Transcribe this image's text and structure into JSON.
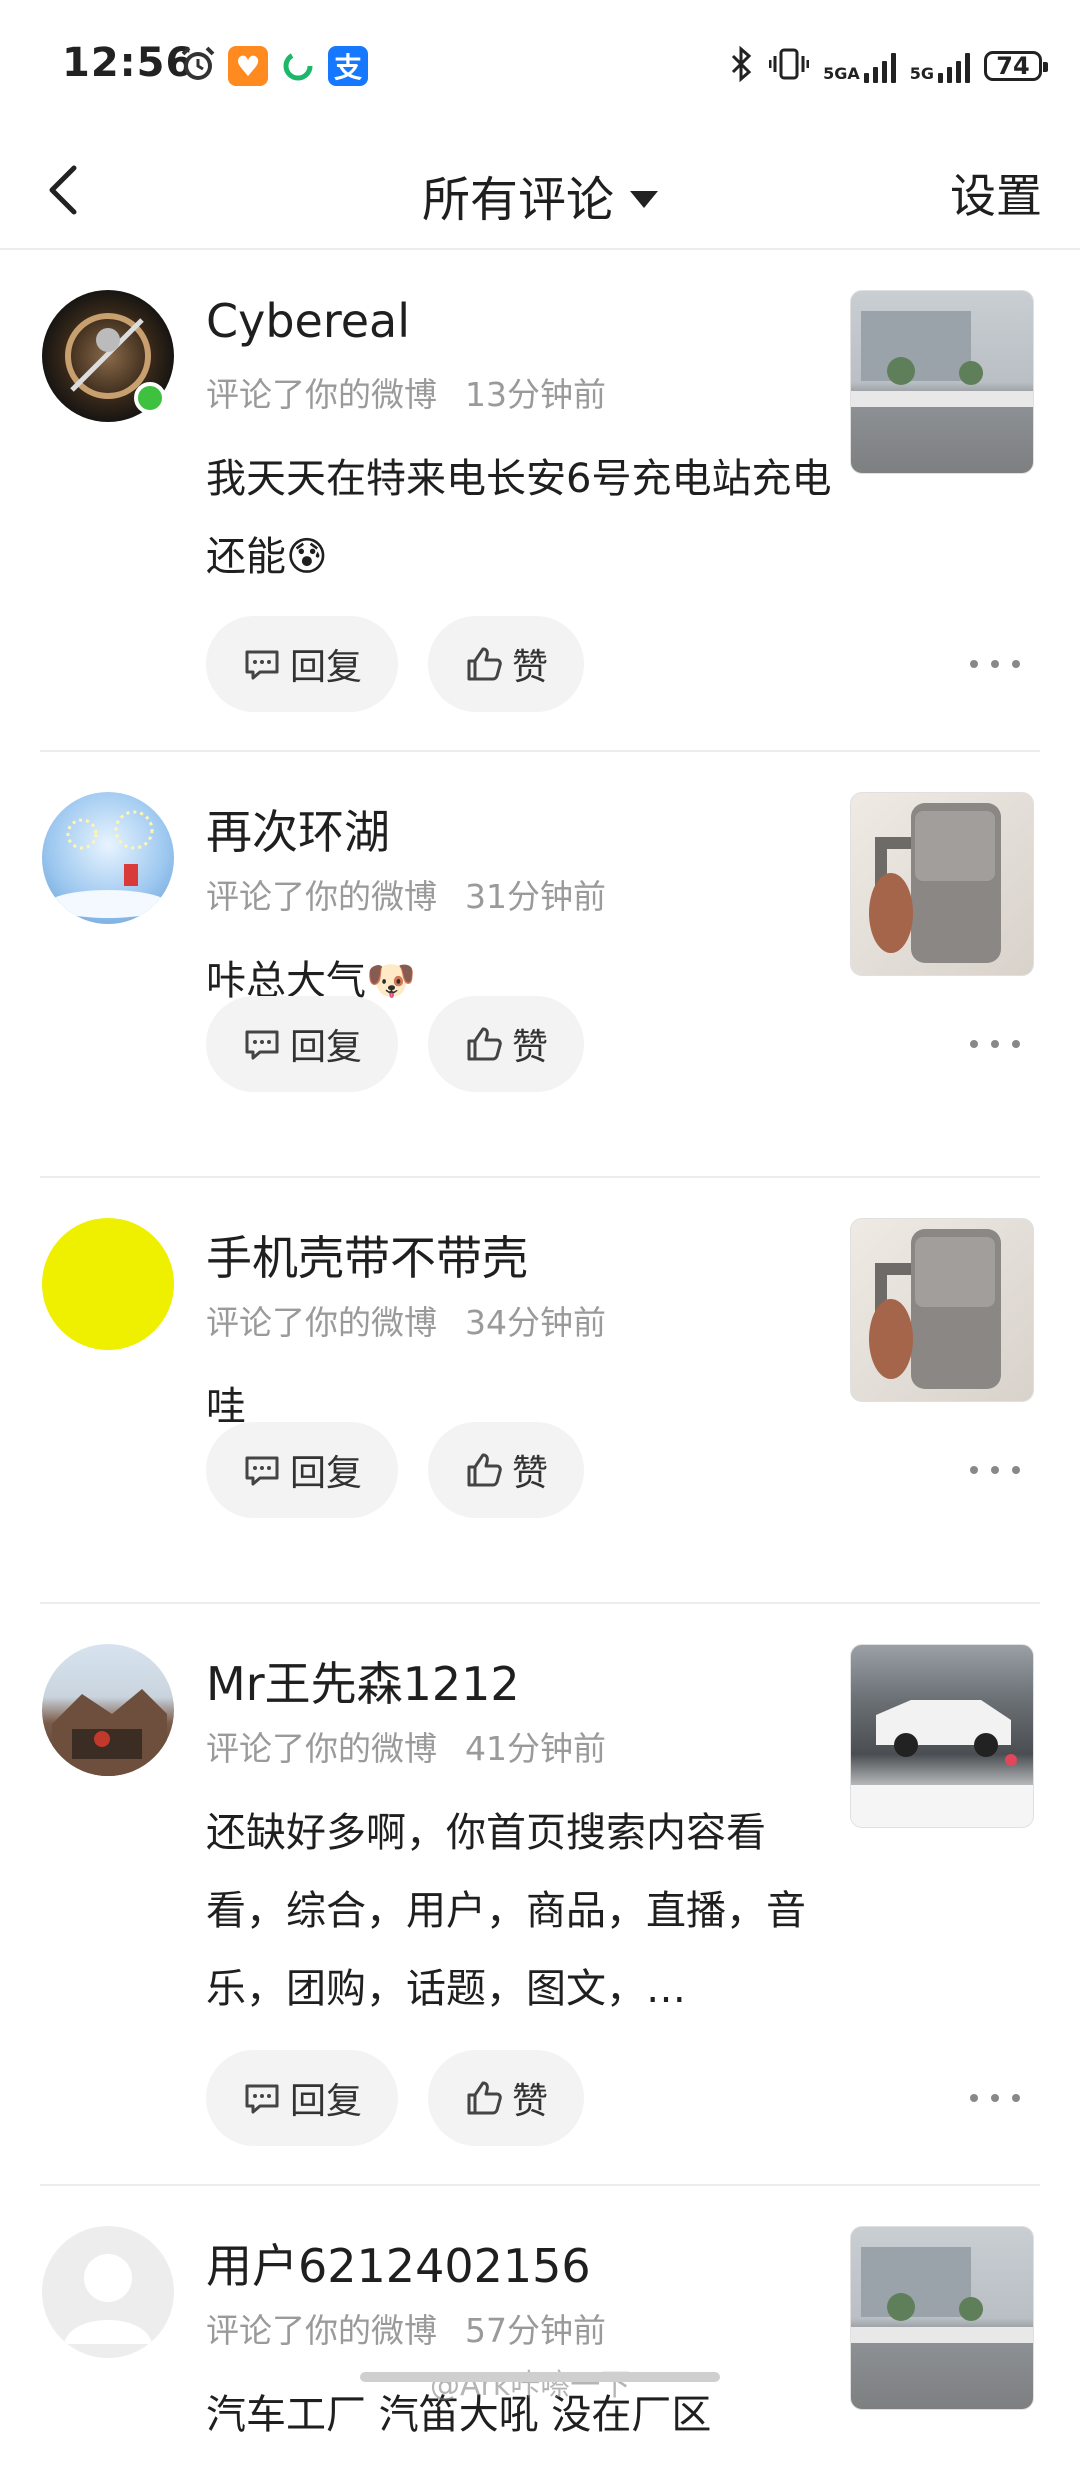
{
  "status": {
    "time": "12:56",
    "network1": "5GA",
    "network2": "5G",
    "battery": "74"
  },
  "nav": {
    "title": "所有评论",
    "settings": "设置"
  },
  "labels": {
    "reply": "回复",
    "like": "赞"
  },
  "comments": [
    {
      "name": "Cybereal",
      "action": "评论了你的微博",
      "time": "13分钟前",
      "text": "我天天在特来电长安6号充电站充电还能😰"
    },
    {
      "name": "再次环湖",
      "action": "评论了你的微博",
      "time": "31分钟前",
      "text": "咔总大气🐶"
    },
    {
      "name": "手机壳带不带壳",
      "action": "评论了你的微博",
      "time": "34分钟前",
      "text": "哇"
    },
    {
      "name": "Mr王先森1212",
      "action": "评论了你的微博",
      "time": "41分钟前",
      "text": "还缺好多啊，你首页搜索内容看看，综合，用户，商品，直播，音乐，团购，话题，图文，…"
    },
    {
      "name": "用户6212402156",
      "action": "评论了你的微博",
      "time": "57分钟前",
      "text": "汽车工厂 汽笛大吼 没在厂区"
    }
  ],
  "colors": {
    "online": "#3ec13e",
    "pill_bg": "#f3f3f3",
    "meta_text": "#9a9a9a"
  },
  "watermark": "@Ark咔嚓一下"
}
